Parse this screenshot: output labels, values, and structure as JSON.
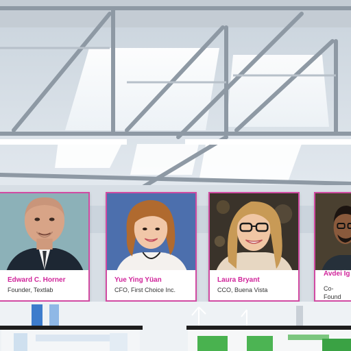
{
  "speakers": [
    {
      "name": "Edward C. Horner",
      "role": "Founder, Textlab"
    },
    {
      "name": "Yue Ying Yüan",
      "role": "CFO, First Choice Inc."
    },
    {
      "name": "Laura Bryant",
      "role": "CCO, Buena Vista"
    },
    {
      "name": "Avdei Ig",
      "role": "Co-Found Corp."
    }
  ],
  "colors": {
    "accent": "#d0249a",
    "card_border": "#d14aa2"
  }
}
